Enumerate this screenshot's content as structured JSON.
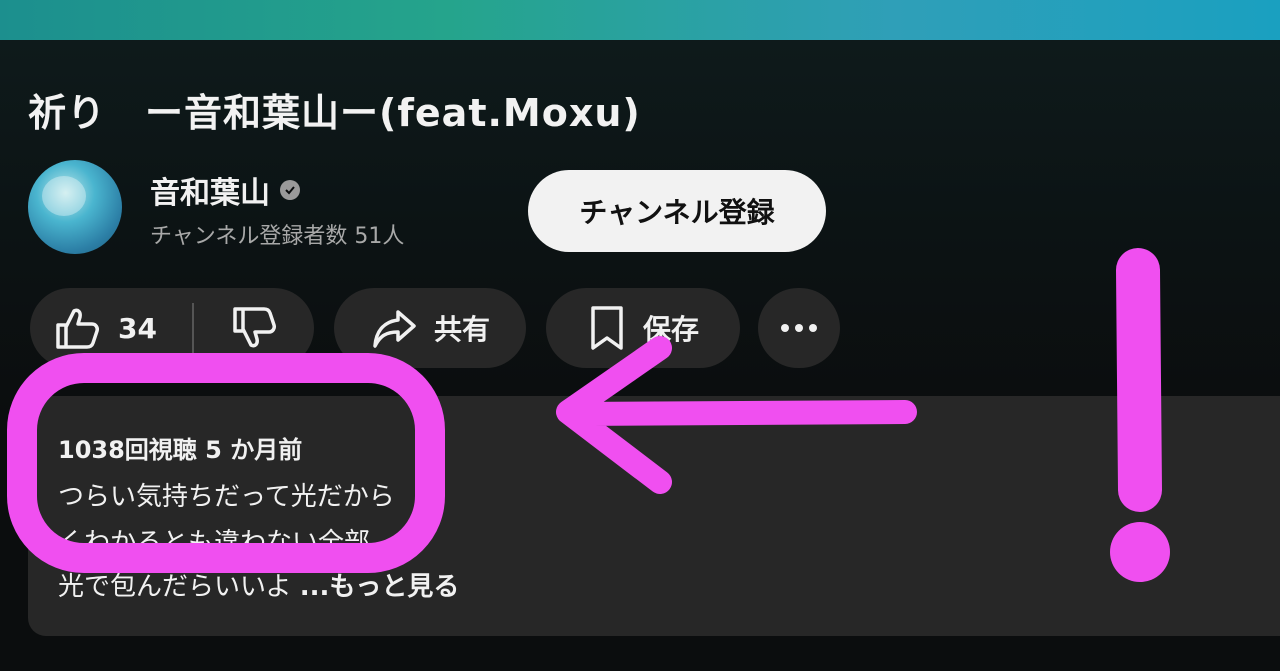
{
  "video": {
    "title": "祈り　ー音和葉山ー(feat.Moxu)"
  },
  "channel": {
    "name": "音和葉山",
    "subscribers": "チャンネル登録者数 51人",
    "subscribe_label": "チャンネル登録"
  },
  "actions": {
    "like_count": "34",
    "share_label": "共有",
    "save_label": "保存"
  },
  "description": {
    "meta": "1038回視聴  5 か月前",
    "line1": "つらい気持ちだって光だから",
    "line2": "くわかるとも違わない全部",
    "line3": "光で包んだらいいよ",
    "more_label": "...もっと見る"
  },
  "icons": [
    "like-icon",
    "dislike-icon",
    "share-icon",
    "save-icon",
    "more-icon",
    "verified-icon"
  ],
  "colors": {
    "annotation": "#f04ff0",
    "background": "#0b0d0e",
    "pill": "#272727",
    "subscribe_bg": "#f2f2f2"
  }
}
